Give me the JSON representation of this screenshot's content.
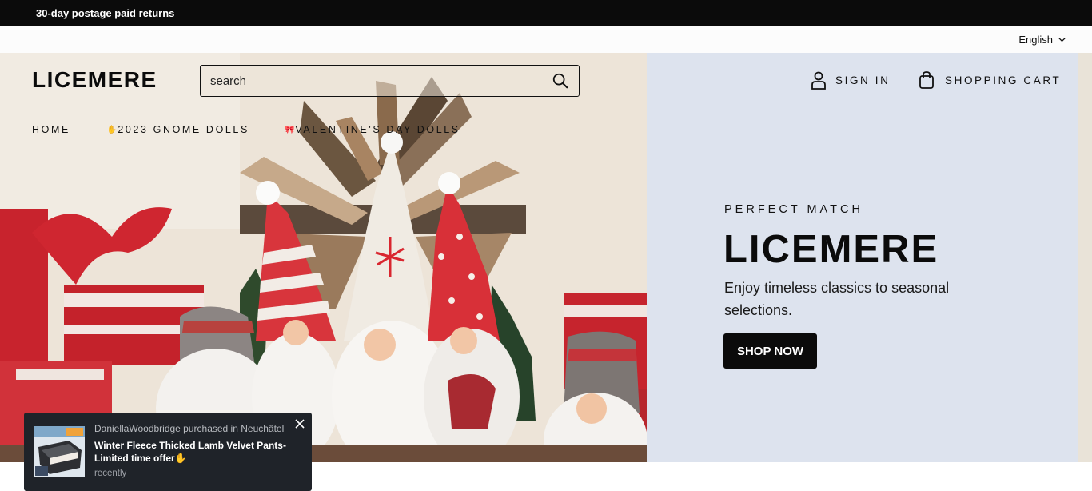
{
  "announcement": "30-day postage paid returns",
  "language": {
    "current": "English"
  },
  "header": {
    "logo": "LICEMERE",
    "search_placeholder": "search",
    "account_label": "SIGN IN",
    "cart_label": "SHOPPING CART"
  },
  "nav": {
    "items": [
      {
        "label": "HOME",
        "emoji": ""
      },
      {
        "label": "2023 GNOME DOLLS",
        "emoji": "✋"
      },
      {
        "label": "VALENTINE'S DAY DOLLS",
        "emoji": "🎀"
      }
    ]
  },
  "hero": {
    "eyebrow": "PERFECT MATCH",
    "headline": "LICEMERE",
    "subtext": "Enjoy timeless classics to seasonal selections.",
    "cta_label": "SHOP NOW"
  },
  "popup": {
    "buyer_line": "DaniellaWoodbridge purchased in Neuchâtel",
    "product": "Winter Fleece Thicked Lamb Velvet Pants-Limited time offer✋",
    "time": "recently"
  },
  "icons": {
    "search": "search-icon",
    "account": "user-icon",
    "cart": "shopping-bag-icon",
    "language": "chevron-down-icon",
    "close": "close-icon"
  },
  "colors": {
    "announcement_bg": "#0b0b0b",
    "hero_panel_bg": "#dde3ee",
    "button_bg": "#0b0b0b",
    "popup_bg": "#1f2329"
  }
}
